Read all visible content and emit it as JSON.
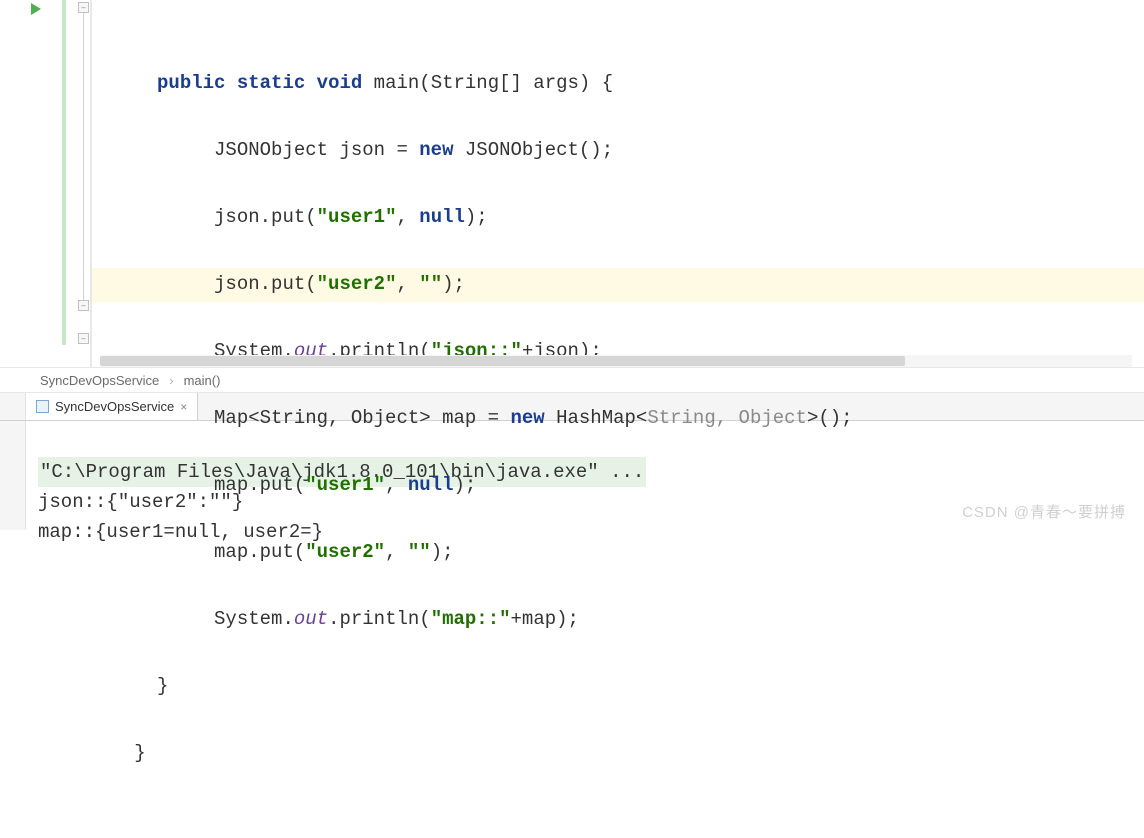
{
  "code": {
    "indent1": "     ",
    "indent2": "          ",
    "l1": {
      "kw1": "public",
      "kw2": "static",
      "kw3": "void",
      "name": " main(String[] args) {"
    },
    "l2": {
      "pre": "JSONObject json = ",
      "kw": "new",
      "post": " JSONObject();"
    },
    "l3": {
      "pre": "json.put(",
      "s": "\"user1\"",
      "mid": ", ",
      "kw": "null",
      "post": ");"
    },
    "l4": {
      "pre": "json.put(",
      "s": "\"user2\"",
      "mid": ", ",
      "s2": "\"\"",
      "post": ");"
    },
    "l5": {
      "pre": "System.",
      "stat": "out",
      "mid": ".println(",
      "s": "\"json::\"",
      "post": "+json);"
    },
    "l6": {
      "pre": "Map<String, Object> map = ",
      "kw": "new",
      "mid": " HashMap<",
      "gen": "String, Object",
      "post": ">();"
    },
    "l7": {
      "pre": "map.put(",
      "s": "\"user1\"",
      "mid": ", ",
      "kw": "null",
      "post": ");"
    },
    "l8": {
      "pre": "map.put(",
      "s": "\"user2\"",
      "mid": ", ",
      "s2": "\"\"",
      "post": ");"
    },
    "l9": {
      "pre": "System.",
      "stat": "out",
      "mid": ".println(",
      "s": "\"map::\"",
      "post": "+map);"
    },
    "l10": "}",
    "l11": "}"
  },
  "breadcrumb": {
    "item1": "SyncDevOpsService",
    "sep": "›",
    "item2": "main()"
  },
  "tab": {
    "label": "SyncDevOpsService",
    "close": "×"
  },
  "output": {
    "cmd": "\"C:\\Program Files\\Java\\jdk1.8.0_101\\bin\\java.exe\" ...",
    "l1": "json::{\"user2\":\"\"}",
    "l2": "map::{user1=null, user2=}"
  },
  "watermark": "CSDN @青春～要拼搏"
}
